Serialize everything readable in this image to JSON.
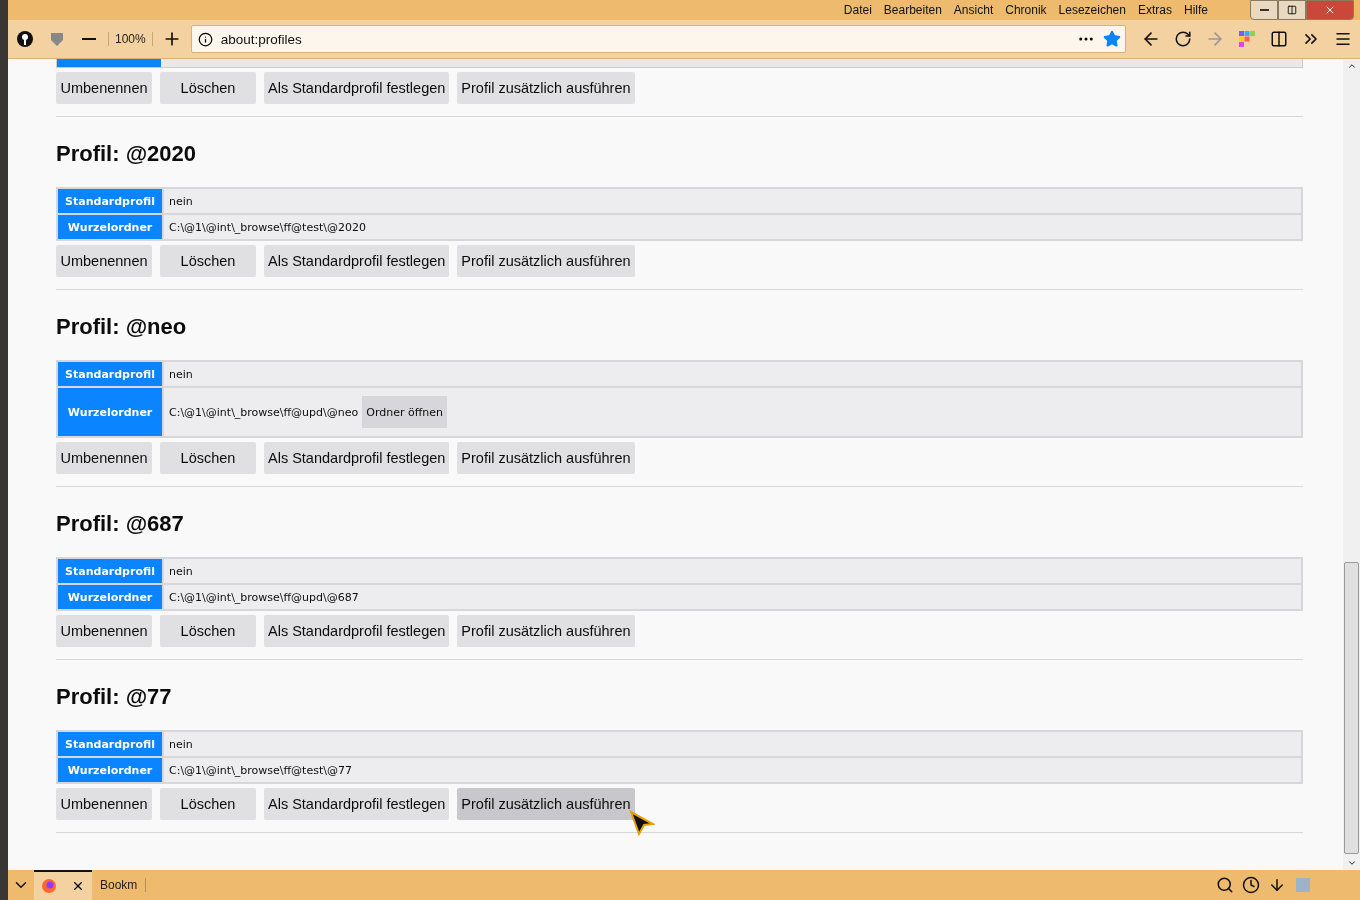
{
  "menu": [
    "Datei",
    "Bearbeiten",
    "Ansicht",
    "Chronik",
    "Lesezeichen",
    "Extras",
    "Hilfe"
  ],
  "toolbar": {
    "zoom": "100%",
    "url": "about:profiles"
  },
  "top_buttons": [
    {
      "label": "Umbenennen",
      "hovered": false
    },
    {
      "label": "Löschen",
      "hovered": false
    },
    {
      "label": "Als Standardprofil festlegen",
      "hovered": false
    },
    {
      "label": "Profil zusätzlich ausführen",
      "hovered": false
    }
  ],
  "profiles": [
    {
      "title": "Profil: @2020",
      "rows": [
        {
          "label": "Standardprofil",
          "value": "nein"
        },
        {
          "label": "Wurzelordner",
          "value": "C:\\@1\\@int\\_browse\\ff@test\\@2020"
        }
      ],
      "buttons": [
        {
          "label": "Umbenennen",
          "hovered": false
        },
        {
          "label": "Löschen",
          "hovered": false
        },
        {
          "label": "Als Standardprofil festlegen",
          "hovered": false
        },
        {
          "label": "Profil zusätzlich ausführen",
          "hovered": false
        }
      ]
    },
    {
      "title": "Profil: @neo",
      "rows": [
        {
          "label": "Standardprofil",
          "value": "nein"
        },
        {
          "label": "Wurzelordner",
          "value": "C:\\@1\\@int\\_browse\\ff@upd\\@neo",
          "action": "Ordner öffnen"
        }
      ],
      "buttons": [
        {
          "label": "Umbenennen",
          "hovered": false
        },
        {
          "label": "Löschen",
          "hovered": false
        },
        {
          "label": "Als Standardprofil festlegen",
          "hovered": false
        },
        {
          "label": "Profil zusätzlich ausführen",
          "hovered": false
        }
      ]
    },
    {
      "title": "Profil: @687",
      "rows": [
        {
          "label": "Standardprofil",
          "value": "nein"
        },
        {
          "label": "Wurzelordner",
          "value": "C:\\@1\\@int\\_browse\\ff@upd\\@687"
        }
      ],
      "buttons": [
        {
          "label": "Umbenennen",
          "hovered": false
        },
        {
          "label": "Löschen",
          "hovered": false
        },
        {
          "label": "Als Standardprofil festlegen",
          "hovered": false
        },
        {
          "label": "Profil zusätzlich ausführen",
          "hovered": false
        }
      ]
    },
    {
      "title": "Profil: @77",
      "rows": [
        {
          "label": "Standardprofil",
          "value": "nein"
        },
        {
          "label": "Wurzelordner",
          "value": "C:\\@1\\@int\\_browse\\ff@test\\@77"
        }
      ],
      "buttons": [
        {
          "label": "Umbenennen",
          "hovered": false
        },
        {
          "label": "Löschen",
          "hovered": false
        },
        {
          "label": "Als Standardprofil festlegen",
          "hovered": false
        },
        {
          "label": "Profil zusätzlich ausführen",
          "hovered": true
        }
      ]
    }
  ],
  "bottom_bar": {
    "bookmarks": "Bookm"
  }
}
